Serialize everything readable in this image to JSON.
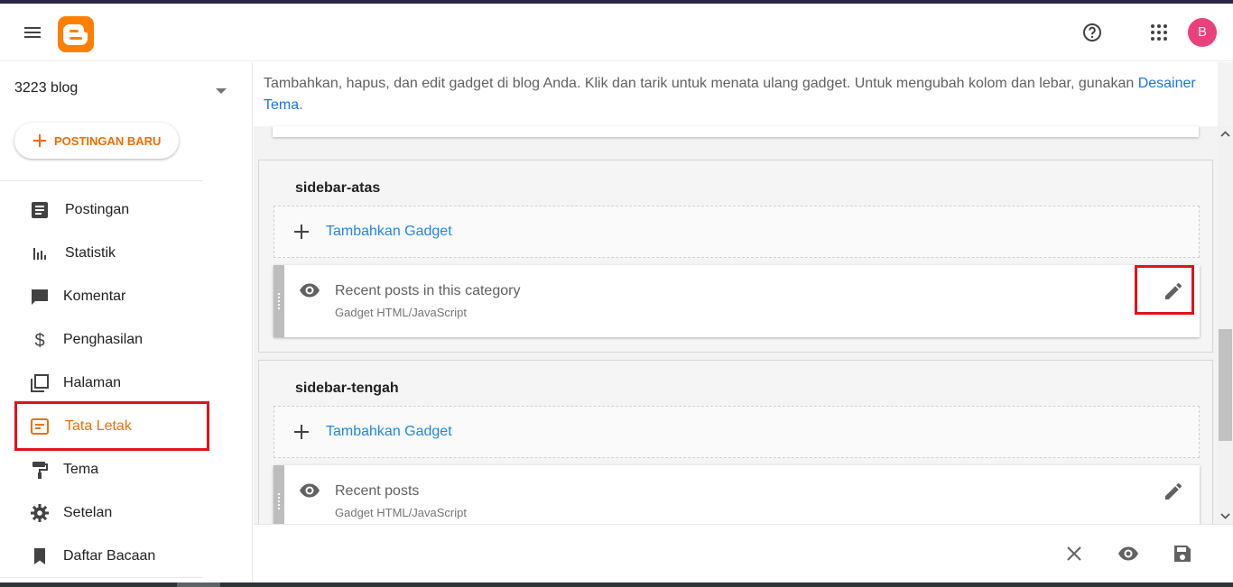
{
  "header": {
    "menu_icon": "menu-icon",
    "logo_icon": "blogger-logo-icon",
    "help_icon": "help-circle-icon",
    "apps_icon": "apps-grid-icon",
    "avatar_letter": "B",
    "avatar_color": "#ec407a"
  },
  "sidebar": {
    "blog_name": "3223 blog",
    "new_post_label": "POSTINGAN BARU",
    "items": [
      {
        "label": "Postingan",
        "icon": "posts-icon"
      },
      {
        "label": "Statistik",
        "icon": "stats-icon"
      },
      {
        "label": "Komentar",
        "icon": "comment-icon"
      },
      {
        "label": "Penghasilan",
        "icon": "dollar-icon"
      },
      {
        "label": "Halaman",
        "icon": "pages-icon"
      },
      {
        "label": "Tata Letak",
        "icon": "layout-icon",
        "active": true
      },
      {
        "label": "Tema",
        "icon": "paint-roller-icon"
      },
      {
        "label": "Setelan",
        "icon": "gear-icon"
      },
      {
        "label": "Daftar Bacaan",
        "icon": "bookmark-icon"
      }
    ],
    "accent_color": "#e8710a"
  },
  "main": {
    "intro_text": "Tambahkan, hapus, dan edit gadget di blog Anda. Klik dan tarik untuk menata ulang gadget. Untuk mengubah kolom dan lebar, gunakan ",
    "intro_link": "Desainer Tema",
    "intro_end": ".",
    "sections": [
      {
        "name": "sidebar-atas",
        "add_label": "Tambahkan Gadget",
        "gadget": {
          "title": "Recent posts in this category",
          "type": "Gadget HTML/JavaScript"
        }
      },
      {
        "name": "sidebar-tengah",
        "add_label": "Tambahkan Gadget",
        "gadget": {
          "title": "Recent posts",
          "type": "Gadget HTML/JavaScript"
        }
      }
    ]
  },
  "actions": {
    "close_icon": "close-icon",
    "preview_icon": "eye-icon",
    "save_icon": "save-icon"
  },
  "highlight_color": "#e4121a"
}
